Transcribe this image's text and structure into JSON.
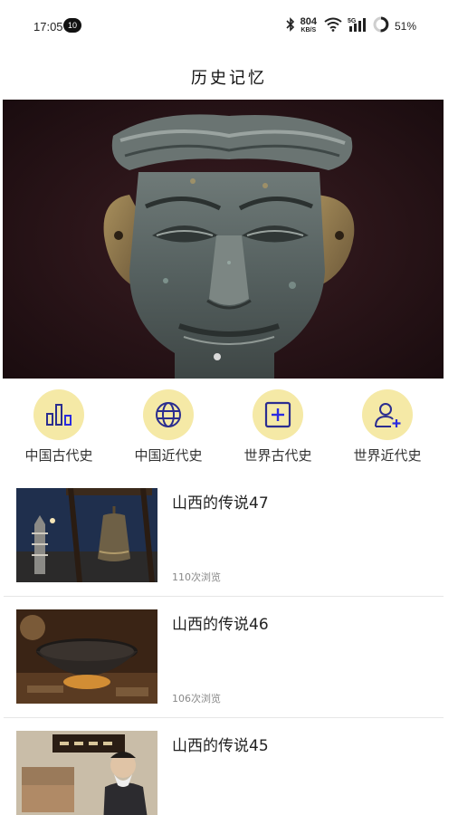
{
  "status": {
    "time": "17:05",
    "notification_count": "10",
    "net_speed": "804",
    "net_speed_unit": "KB/S",
    "network_type": "5G",
    "battery": "51%"
  },
  "header": {
    "title": "历史记忆"
  },
  "banner": {
    "image": "bronze-mask-photo",
    "active_dot": 1,
    "dot_count": 1
  },
  "categories": [
    {
      "label": "中国古代史",
      "icon": "bar-chart-icon"
    },
    {
      "label": "中国近代史",
      "icon": "globe-icon"
    },
    {
      "label": "世界古代史",
      "icon": "plus-square-icon"
    },
    {
      "label": "世界近代史",
      "icon": "add-user-icon"
    }
  ],
  "articles": [
    {
      "title": "山西的传说47",
      "views": "110次浏览",
      "thumb": "pagoda-bell-night"
    },
    {
      "title": "山西的传说46",
      "views": "106次浏览",
      "thumb": "iron-wok-fire"
    },
    {
      "title": "山西的传说45",
      "views": "",
      "thumb": "old-man-shop-sign"
    }
  ],
  "colors": {
    "category_bg": "#f5e9a6",
    "category_icon": "#2b2d8f",
    "accent_blue": "#2b2be0"
  }
}
